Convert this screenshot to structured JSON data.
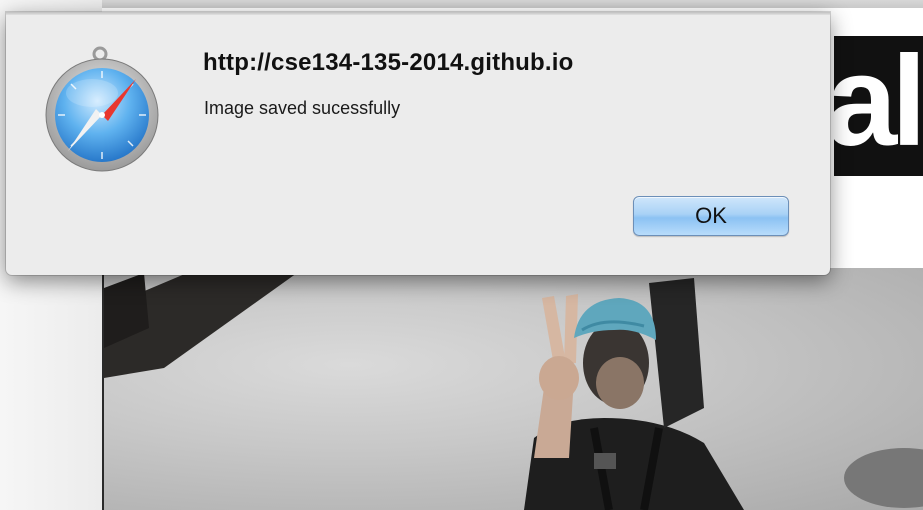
{
  "dialog": {
    "title": "http://cse134-135-2014.github.io",
    "message": "Image saved sucessfully",
    "ok_label": "OK",
    "icon": "safari-compass-icon"
  },
  "background": {
    "banner_text": "al"
  },
  "colors": {
    "dialog_bg": "#ececec",
    "button_blue": "#a9d2f6",
    "banner_bg": "#111111"
  }
}
